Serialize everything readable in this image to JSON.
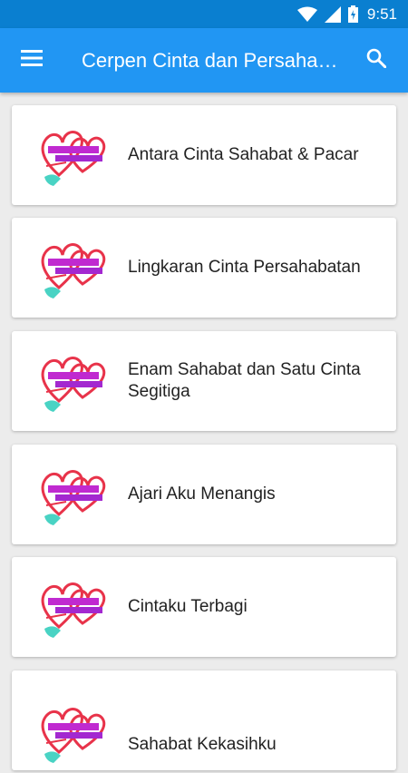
{
  "status_bar": {
    "time": "9:51",
    "icons": [
      "wifi-icon",
      "signal-icon",
      "battery-icon"
    ]
  },
  "app_bar": {
    "title": "Cerpen Cinta dan Persahabatan",
    "menu_icon": "menu-icon",
    "search_icon": "search-icon"
  },
  "colors": {
    "app_bar": "#2196f3",
    "status_bar": "#0a7fd0",
    "background": "#ececec"
  },
  "stories": [
    {
      "title": "Antara Cinta Sahabat & Pacar"
    },
    {
      "title": "Lingkaran Cinta Persahabatan"
    },
    {
      "title": "Enam Sahabat dan Satu Cinta Segitiga"
    },
    {
      "title": "Ajari Aku Menangis"
    },
    {
      "title": "Cintaku Terbagi"
    },
    {
      "title": "Sahabat Kekasihku"
    }
  ]
}
